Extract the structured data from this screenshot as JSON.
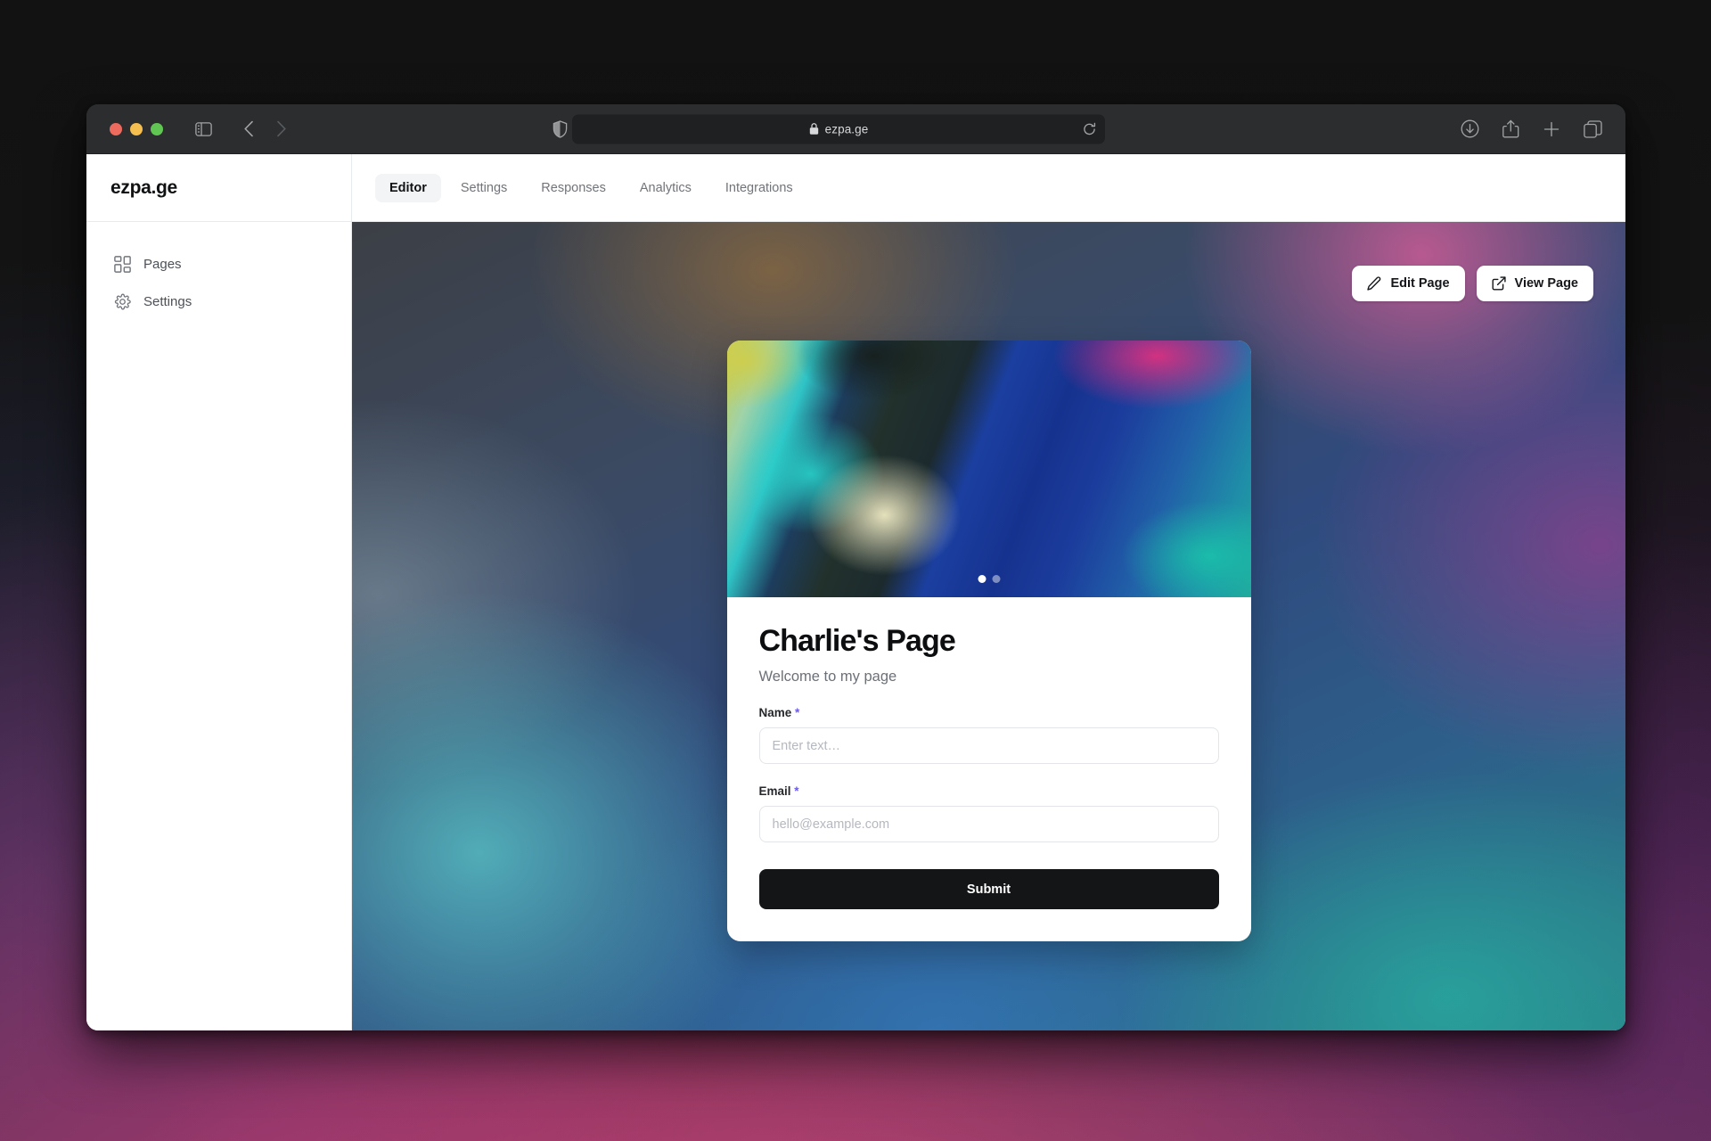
{
  "browser": {
    "window_controls": [
      "close",
      "minimize",
      "maximize"
    ],
    "sidebar_toggle_icon": "sidebar-toggle-icon",
    "back_icon": "chevron-left-icon",
    "forward_icon": "chevron-right-icon",
    "shield_icon": "shield-icon",
    "lock_icon": "lock-icon",
    "url": "ezpa.ge",
    "reload_icon": "reload-icon",
    "right_icons": [
      "downloads-icon",
      "share-icon",
      "new-tab-icon",
      "tab-overview-icon"
    ]
  },
  "app": {
    "brand": "ezpa.ge",
    "tabs": [
      {
        "label": "Editor",
        "active": true
      },
      {
        "label": "Settings",
        "active": false
      },
      {
        "label": "Responses",
        "active": false
      },
      {
        "label": "Analytics",
        "active": false
      },
      {
        "label": "Integrations",
        "active": false
      }
    ],
    "sidebar": {
      "items": [
        {
          "label": "Pages",
          "icon": "grid-icon"
        },
        {
          "label": "Settings",
          "icon": "gear-icon"
        }
      ]
    },
    "page_actions": [
      {
        "label": "Edit Page",
        "icon": "pencil-icon"
      },
      {
        "label": "View Page",
        "icon": "external-link-icon"
      }
    ]
  },
  "page_card": {
    "hero": {
      "dots": [
        {
          "active": true
        },
        {
          "active": false
        }
      ]
    },
    "title": "Charlie's Page",
    "subtitle": "Welcome to my page",
    "fields": [
      {
        "label": "Name",
        "required_marker": "*",
        "placeholder": "Enter text…",
        "value": ""
      },
      {
        "label": "Email",
        "required_marker": "*",
        "placeholder": "hello@example.com",
        "value": ""
      }
    ],
    "submit_label": "Submit"
  },
  "colors": {
    "accent_required": "#6c5ce7",
    "submit_bg": "#141517",
    "tab_active_bg": "#f3f4f5",
    "card_bg": "#ffffff"
  }
}
